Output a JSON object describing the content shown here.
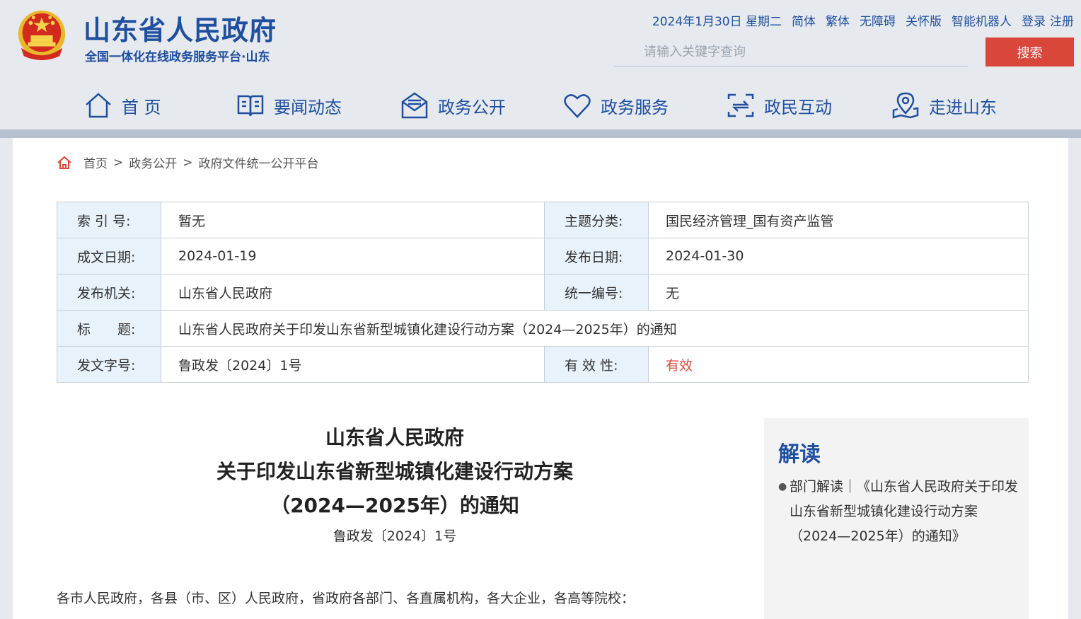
{
  "site": {
    "title": "山东省人民政府",
    "subtitle": "全国一体化在线政务服务平台·山东"
  },
  "toplinks": {
    "date": "2024年1月30日 星期二",
    "simplified": "简体",
    "traditional": "繁体",
    "accessibility": "无障碍",
    "elder": "关怀版",
    "robot": "智能机器人",
    "login": "登录",
    "register": "注册"
  },
  "search": {
    "placeholder": "请输入关键字查询",
    "button": "搜索"
  },
  "nav": {
    "items": [
      {
        "label": "首 页",
        "icon": "home-icon"
      },
      {
        "label": "要闻动态",
        "icon": "book-icon"
      },
      {
        "label": "政务公开",
        "icon": "mail-icon"
      },
      {
        "label": "政务服务",
        "icon": "heart-icon"
      },
      {
        "label": "政民互动",
        "icon": "interact-icon"
      },
      {
        "label": "走进山东",
        "icon": "location-icon"
      }
    ]
  },
  "breadcrumb": {
    "home": "首页",
    "sep": ">",
    "level1": "政务公开",
    "level2": "政府文件统一公开平台"
  },
  "meta": {
    "index_label": "索 引 号:",
    "index_value": "暂无",
    "topic_label": "主题分类:",
    "topic_value": "国民经济管理_国有资产监管",
    "written_label": "成文日期:",
    "written_value": "2024-01-19",
    "publish_label": "发布日期:",
    "publish_value": "2024-01-30",
    "org_label": "发布机关:",
    "org_value": "山东省人民政府",
    "code_label": "统一编号:",
    "code_value": "无",
    "title_label": "标　　题:",
    "title_value": "山东省人民政府关于印发山东省新型城镇化建设行动方案（2024—2025年）的通知",
    "docno_label": "发文字号:",
    "docno_value": "鲁政发〔2024〕1号",
    "valid_label": "有 效 性:",
    "valid_value": "有效"
  },
  "document": {
    "title_line1": "山东省人民政府",
    "title_line2": "关于印发山东省新型城镇化建设行动方案",
    "title_line3": "（2024—2025年）的通知",
    "number": "鲁政发〔2024〕1号",
    "salutation": "各市人民政府，各县（市、区）人民政府，省政府各部门、各直属机构，各大企业，各高等院校："
  },
  "sidebar": {
    "title": "解读",
    "item": "部门解读｜《山东省人民政府关于印发山东省新型城镇化建设行动方案（2024—2025年）的通知》"
  },
  "colors": {
    "brand_blue": "#1f4f9e",
    "search_red": "#d9463a",
    "label_bg": "#e8f2fb"
  }
}
